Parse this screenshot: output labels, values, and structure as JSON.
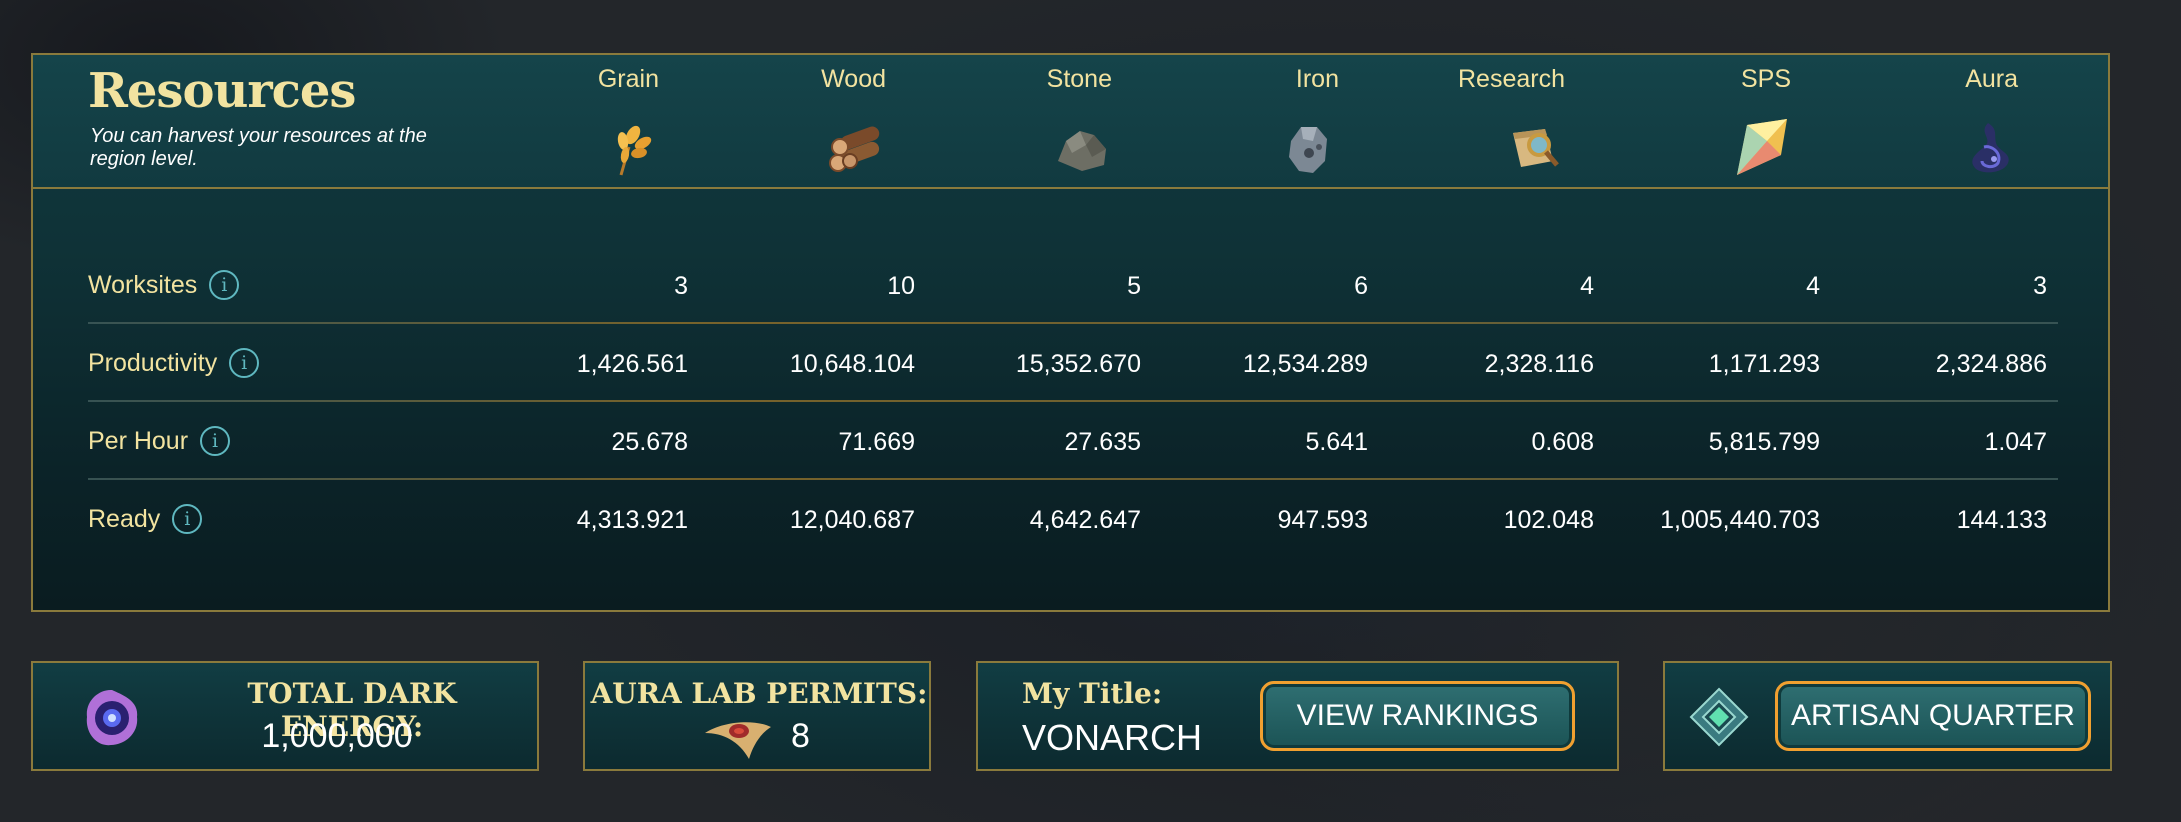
{
  "header": {
    "title": "Resources",
    "subtitle": "You can harvest your resources at the region level."
  },
  "columns": [
    {
      "name": "Grain",
      "icon": "wheat-icon"
    },
    {
      "name": "Wood",
      "icon": "logs-icon"
    },
    {
      "name": "Stone",
      "icon": "stone-icon"
    },
    {
      "name": "Iron",
      "icon": "iron-ore-icon"
    },
    {
      "name": "Research",
      "icon": "scroll-magnifier-icon"
    },
    {
      "name": "SPS",
      "icon": "sps-crystal-icon"
    },
    {
      "name": "Aura",
      "icon": "aura-swirl-icon"
    }
  ],
  "rows": [
    {
      "label": "Worksites",
      "values": [
        "3",
        "10",
        "5",
        "6",
        "4",
        "4",
        "3"
      ]
    },
    {
      "label": "Productivity",
      "values": [
        "1,426.561",
        "10,648.104",
        "15,352.670",
        "12,534.289",
        "2,328.116",
        "1,171.293",
        "2,324.886"
      ]
    },
    {
      "label": "Per Hour",
      "values": [
        "25.678",
        "71.669",
        "27.635",
        "5.641",
        "0.608",
        "5,815.799",
        "1.047"
      ]
    },
    {
      "label": "Ready",
      "values": [
        "4,313.921",
        "12,040.687",
        "4,642.647",
        "947.593",
        "102.048",
        "1,005,440.703",
        "144.133"
      ]
    }
  ],
  "info_glyph": "i",
  "footer": {
    "dark_energy": {
      "label": "TOTAL DARK ENERGY:",
      "value": "1,000,000",
      "icon": "dark-energy-orb-icon"
    },
    "aura_permits": {
      "label": "AURA LAB PERMITS:",
      "value": "8",
      "icon": "permit-feather-icon"
    },
    "title": {
      "label": "My Title:",
      "value": "VONARCH",
      "button": "VIEW RANKINGS"
    },
    "artisan": {
      "button": "ARTISAN QUARTER",
      "icon": "artisan-diamond-icon"
    }
  },
  "colors": {
    "gold_text": "#f2e3a0",
    "border_gold": "#8a7a3c",
    "button_orange": "#f0a030",
    "info_teal": "#5fb8c0"
  }
}
